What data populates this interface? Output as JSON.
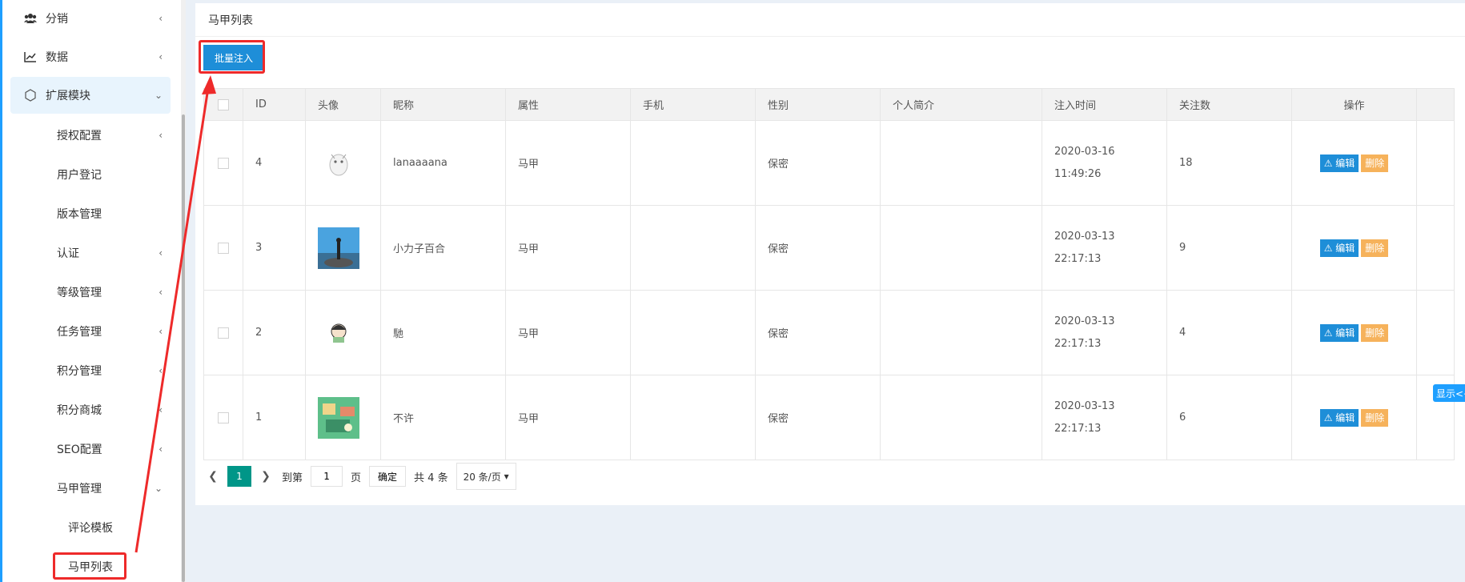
{
  "sidebar": {
    "items": [
      {
        "label": "分销",
        "icon": "users-icon"
      },
      {
        "label": "数据",
        "icon": "chart-line-icon"
      },
      {
        "label": "扩展模块",
        "icon": "hexagon-icon"
      }
    ],
    "sub_items": [
      {
        "label": "授权配置"
      },
      {
        "label": "用户登记"
      },
      {
        "label": "版本管理"
      },
      {
        "label": "认证"
      },
      {
        "label": "等级管理"
      },
      {
        "label": "任务管理"
      },
      {
        "label": "积分管理"
      },
      {
        "label": "积分商城"
      },
      {
        "label": "SEO配置"
      },
      {
        "label": "马甲管理"
      }
    ],
    "leaf_items": [
      {
        "label": "评论模板"
      },
      {
        "label": "马甲列表"
      }
    ]
  },
  "panel": {
    "title": "马甲列表",
    "batch_button": "批量注入"
  },
  "table": {
    "headers": [
      "ID",
      "头像",
      "昵称",
      "属性",
      "手机",
      "性别",
      "个人简介",
      "注入时间",
      "关注数",
      "操作"
    ],
    "rows": [
      {
        "id": "4",
        "nickname": "lanaaaana",
        "attr": "马甲",
        "phone": "",
        "gender": "保密",
        "bio": "",
        "date": "2020-03-16",
        "time": "11:49:26",
        "follows": "18"
      },
      {
        "id": "3",
        "nickname": "小力子百合",
        "attr": "马甲",
        "phone": "",
        "gender": "保密",
        "bio": "",
        "date": "2020-03-13",
        "time": "22:17:13",
        "follows": "9"
      },
      {
        "id": "2",
        "nickname": "馳",
        "attr": "马甲",
        "phone": "",
        "gender": "保密",
        "bio": "",
        "date": "2020-03-13",
        "time": "22:17:13",
        "follows": "4"
      },
      {
        "id": "1",
        "nickname": "不许",
        "attr": "马甲",
        "phone": "",
        "gender": "保密",
        "bio": "",
        "date": "2020-03-13",
        "time": "22:17:13",
        "follows": "6"
      }
    ],
    "edit_label": "编辑",
    "delete_label": "删除"
  },
  "pager": {
    "current": "1",
    "goto_label": "到第",
    "goto_value": "1",
    "page_label": "页",
    "confirm_label": "确定",
    "total_label": "共 4 条",
    "page_size": "20 条/页"
  },
  "float_tag": "显示<<",
  "colors": {
    "primary": "#1e8ed8",
    "pager_current": "#009688",
    "delete": "#f6b25b",
    "annotation": "#ee2a2a"
  }
}
